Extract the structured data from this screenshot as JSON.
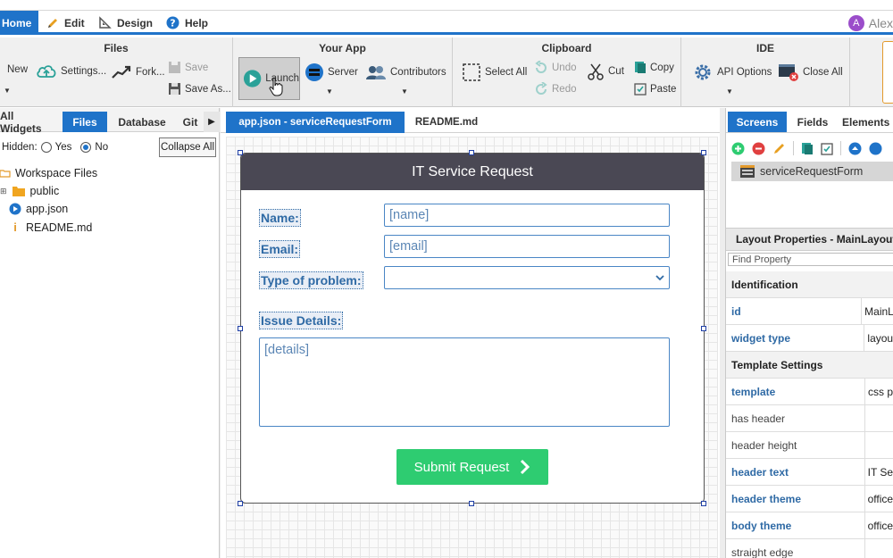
{
  "menu": {
    "items": [
      {
        "label": "Home",
        "icon": "home-icon"
      },
      {
        "label": "Edit",
        "icon": "pencil-icon"
      },
      {
        "label": "Design",
        "icon": "design-icon"
      },
      {
        "label": "Help",
        "icon": "help-icon"
      }
    ],
    "user": {
      "initial": "A",
      "name": "Alex"
    }
  },
  "ribbon": {
    "files": {
      "title": "Files",
      "new": "New",
      "settings": "Settings...",
      "fork": "Fork...",
      "save": "Save",
      "save_as": "Save As..."
    },
    "your_app": {
      "title": "Your App",
      "launch": "Launch",
      "server": "Server",
      "contributors": "Contributors"
    },
    "clipboard": {
      "title": "Clipboard",
      "select_all": "Select All",
      "undo": "Undo",
      "redo": "Redo",
      "cut": "Cut",
      "copy": "Copy",
      "paste": "Paste"
    },
    "ide": {
      "title": "IDE",
      "api_options": "API Options",
      "close_all": "Close All"
    }
  },
  "left_panel": {
    "tabs": [
      "All Widgets",
      "Files",
      "Database",
      "Git"
    ],
    "active_tab": "Files",
    "hidden_label": "Hidden:",
    "yes": "Yes",
    "no": "No",
    "collapse_all": "Collapse All",
    "tree": [
      "Workspace Files",
      "public",
      "app.json",
      "README.md"
    ]
  },
  "editor": {
    "tabs": [
      "app.json - serviceRequestForm",
      "README.md"
    ],
    "form": {
      "title": "IT Service Request",
      "name_label": "Name:",
      "name_placeholder": "[name]",
      "email_label": "Email:",
      "email_placeholder": "[email]",
      "problem_label": "Type of problem:",
      "problem_value": "",
      "details_label": "Issue Details:",
      "details_placeholder": "[details]",
      "submit": "Submit Request"
    }
  },
  "right_panel": {
    "tabs": [
      "Screens",
      "Fields",
      "Elements"
    ],
    "screen_item": "serviceRequestForm",
    "props_title": "Layout Properties - MainLayout",
    "find_property": "Find Property",
    "rows": [
      {
        "type": "section",
        "key": "Identification"
      },
      {
        "type": "bold",
        "key": "id",
        "value": "MainL"
      },
      {
        "type": "bold",
        "key": "widget type",
        "value": "layou"
      },
      {
        "type": "section",
        "key": "Template Settings"
      },
      {
        "type": "bold",
        "key": "template",
        "value": "css p"
      },
      {
        "type": "plain",
        "key": "has header",
        "value": ""
      },
      {
        "type": "plain",
        "key": "header height",
        "value": ""
      },
      {
        "type": "bold",
        "key": "header text",
        "value": "IT Se"
      },
      {
        "type": "bold",
        "key": "header theme",
        "value": "office"
      },
      {
        "type": "bold",
        "key": "body theme",
        "value": "office"
      },
      {
        "type": "plain",
        "key": "straight edge",
        "value": ""
      }
    ]
  },
  "colors": {
    "accent": "#1f73c9",
    "header": "#4a4854",
    "submit": "#2ecc71",
    "label": "#2f6aa5"
  }
}
